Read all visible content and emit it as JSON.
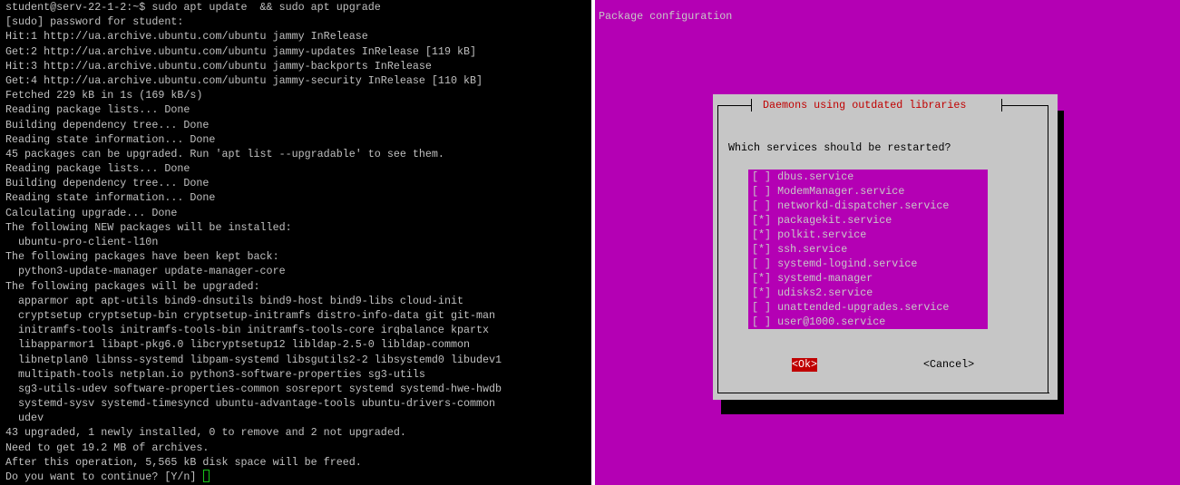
{
  "terminal": {
    "lines": [
      "student@serv-22-1-2:~$ sudo apt update  && sudo apt upgrade",
      "[sudo] password for student:",
      "Hit:1 http://ua.archive.ubuntu.com/ubuntu jammy InRelease",
      "Get:2 http://ua.archive.ubuntu.com/ubuntu jammy-updates InRelease [119 kB]",
      "Hit:3 http://ua.archive.ubuntu.com/ubuntu jammy-backports InRelease",
      "Get:4 http://ua.archive.ubuntu.com/ubuntu jammy-security InRelease [110 kB]",
      "Fetched 229 kB in 1s (169 kB/s)",
      "Reading package lists... Done",
      "Building dependency tree... Done",
      "Reading state information... Done",
      "45 packages can be upgraded. Run 'apt list --upgradable' to see them.",
      "Reading package lists... Done",
      "Building dependency tree... Done",
      "Reading state information... Done",
      "Calculating upgrade... Done",
      "The following NEW packages will be installed:",
      "  ubuntu-pro-client-l10n",
      "The following packages have been kept back:",
      "  python3-update-manager update-manager-core",
      "The following packages will be upgraded:",
      "  apparmor apt apt-utils bind9-dnsutils bind9-host bind9-libs cloud-init",
      "  cryptsetup cryptsetup-bin cryptsetup-initramfs distro-info-data git git-man",
      "  initramfs-tools initramfs-tools-bin initramfs-tools-core irqbalance kpartx",
      "  libapparmor1 libapt-pkg6.0 libcryptsetup12 libldap-2.5-0 libldap-common",
      "  libnetplan0 libnss-systemd libpam-systemd libsgutils2-2 libsystemd0 libudev1",
      "  multipath-tools netplan.io python3-software-properties sg3-utils",
      "  sg3-utils-udev software-properties-common sosreport systemd systemd-hwe-hwdb",
      "  systemd-sysv systemd-timesyncd ubuntu-advantage-tools ubuntu-drivers-common",
      "  udev",
      "43 upgraded, 1 newly installed, 0 to remove and 2 not upgraded.",
      "Need to get 19.2 MB of archives.",
      "After this operation, 5,565 kB disk space will be freed.",
      "Do you want to continue? [Y/n] "
    ],
    "cursor_color": "#18c218"
  },
  "dialog": {
    "screen_title": "Package configuration",
    "title": "Daemons using outdated libraries",
    "question": "Which services should be restarted?",
    "services": [
      {
        "mark": "[ ]",
        "name": "dbus.service"
      },
      {
        "mark": "[ ]",
        "name": "ModemManager.service"
      },
      {
        "mark": "[ ]",
        "name": "networkd-dispatcher.service"
      },
      {
        "mark": "[*]",
        "name": "packagekit.service"
      },
      {
        "mark": "[*]",
        "name": "polkit.service"
      },
      {
        "mark": "[*]",
        "name": "ssh.service"
      },
      {
        "mark": "[ ]",
        "name": "systemd-logind.service"
      },
      {
        "mark": "[*]",
        "name": "systemd-manager"
      },
      {
        "mark": "[*]",
        "name": "udisks2.service"
      },
      {
        "mark": "[ ]",
        "name": "unattended-upgrades.service"
      },
      {
        "mark": "[ ]",
        "name": "user@1000.service"
      }
    ],
    "ok_label": "<Ok>",
    "cancel_label": "<Cancel>"
  },
  "colors": {
    "terminal_bg": "#000000",
    "terminal_fg": "#c0c0c0",
    "config_bg": "#b400b4",
    "dialog_bg": "#c6c6c6",
    "dialog_title": "#c00000"
  }
}
